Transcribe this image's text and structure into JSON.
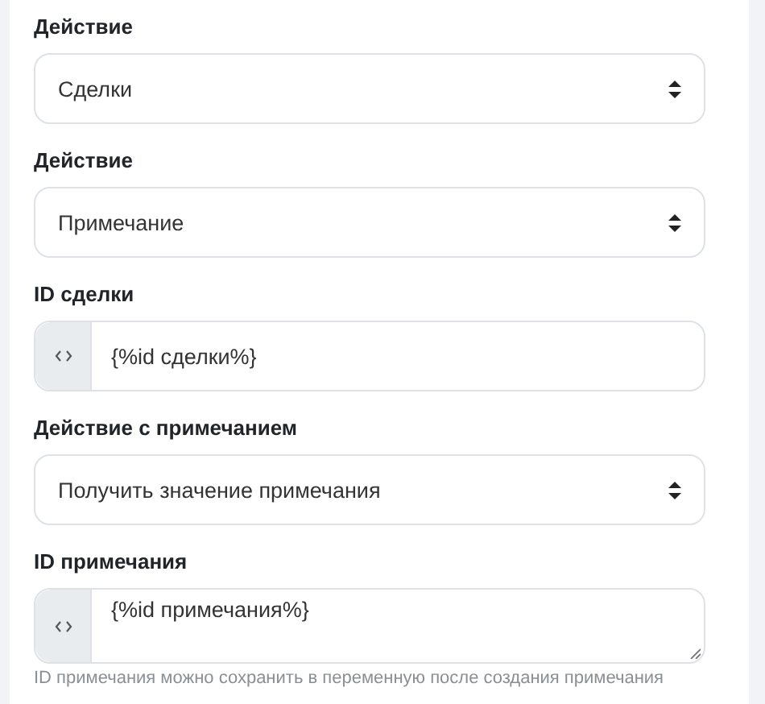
{
  "fields": [
    {
      "label": "Действие",
      "kind": "select",
      "value": "Сделки"
    },
    {
      "label": "Действие",
      "kind": "select",
      "value": "Примечание"
    },
    {
      "label": "ID сделки",
      "kind": "input",
      "value": "{%id сделки%}"
    },
    {
      "label": "Действие с примечанием",
      "kind": "select",
      "value": "Получить значение примечания"
    },
    {
      "label": "ID примечания",
      "kind": "textarea",
      "value": "{%id примечания%}",
      "hint": "ID примечания можно сохранить в переменную после создания примечания"
    }
  ]
}
